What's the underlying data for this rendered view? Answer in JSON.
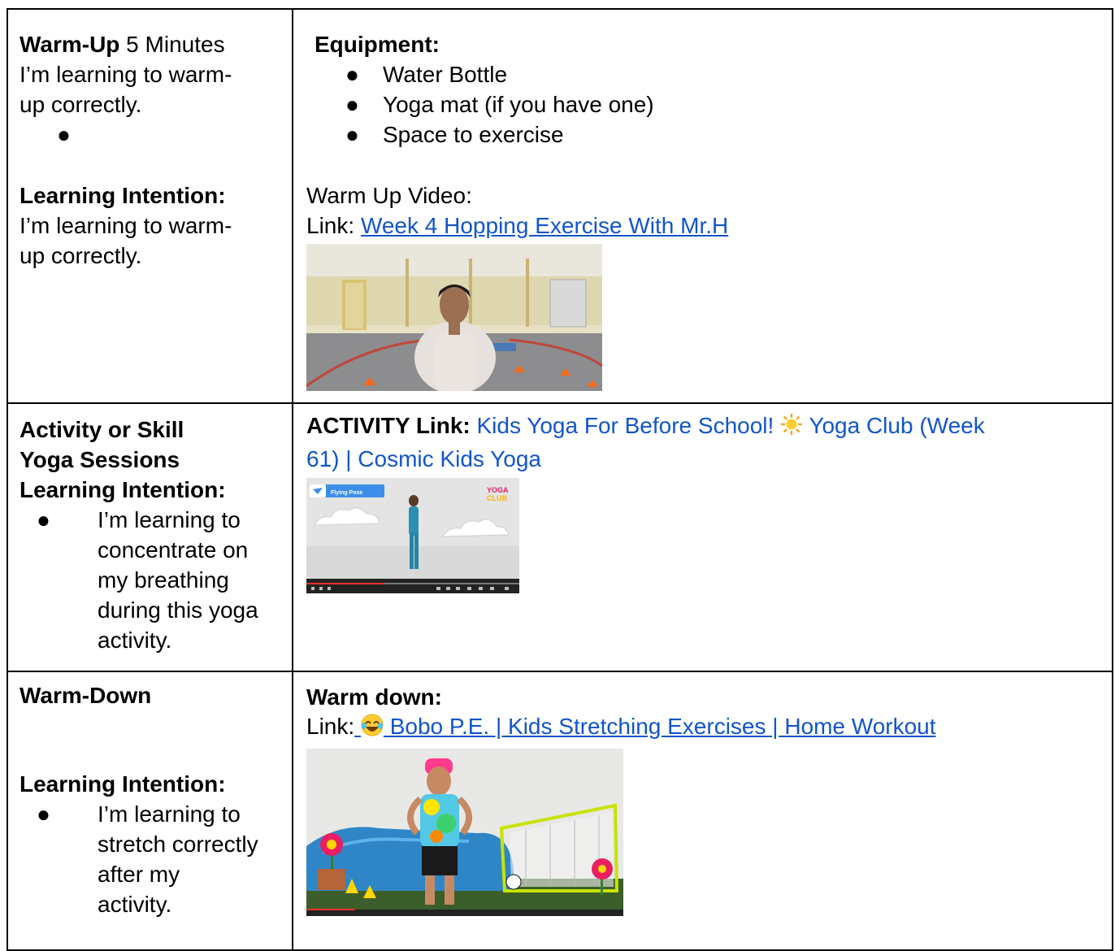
{
  "row1": {
    "left": {
      "heading_bold": "Warm-Up",
      "heading_rest": " 5 Minutes",
      "line1": "I’m learning to warm-",
      "line2": "up correctly.",
      "li_title": "Learning Intention:",
      "li_line1": "I’m learning to warm-",
      "li_line2": "up correctly."
    },
    "right": {
      "equipment_label": "Equipment:",
      "equipment_items": [
        "Water Bottle",
        "Yoga mat (if you have one)",
        "Space to exercise"
      ],
      "video_label": "Warm Up Video:",
      "link_prefix": "Link: ",
      "link_text": "Week 4 Hopping Exercise With Mr.H"
    }
  },
  "row2": {
    "left": {
      "title1": "Activity or Skill",
      "title2": "Yoga Sessions",
      "li_title": "Learning Intention:",
      "bullet_lines": [
        "I’m learning to",
        "concentrate on",
        "my breathing",
        "during this yoga",
        "activity."
      ]
    },
    "right": {
      "activity_label": "ACTIVITY  Link:",
      "link_part1": " Kids Yoga For Before School! ",
      "link_part2": " Yoga Club (Week",
      "link_part3": "61) | Cosmic Kids Yoga",
      "thumb_badge": "Flying Pose",
      "thumb_logo_top": "YOGA",
      "thumb_logo_bottom": "CLUB"
    }
  },
  "row3": {
    "left": {
      "title": "Warm-Down",
      "li_title": "Learning Intention:",
      "bullet_lines": [
        "I’m learning to",
        "stretch correctly",
        "after my",
        "activity."
      ]
    },
    "right": {
      "label": "Warm down:",
      "link_prefix": "Link:",
      "link_text": " Bobo P.E. | Kids Stretching Exercises | Home Workout"
    }
  },
  "colors": {
    "link": "#1155cc",
    "border": "#000000"
  }
}
